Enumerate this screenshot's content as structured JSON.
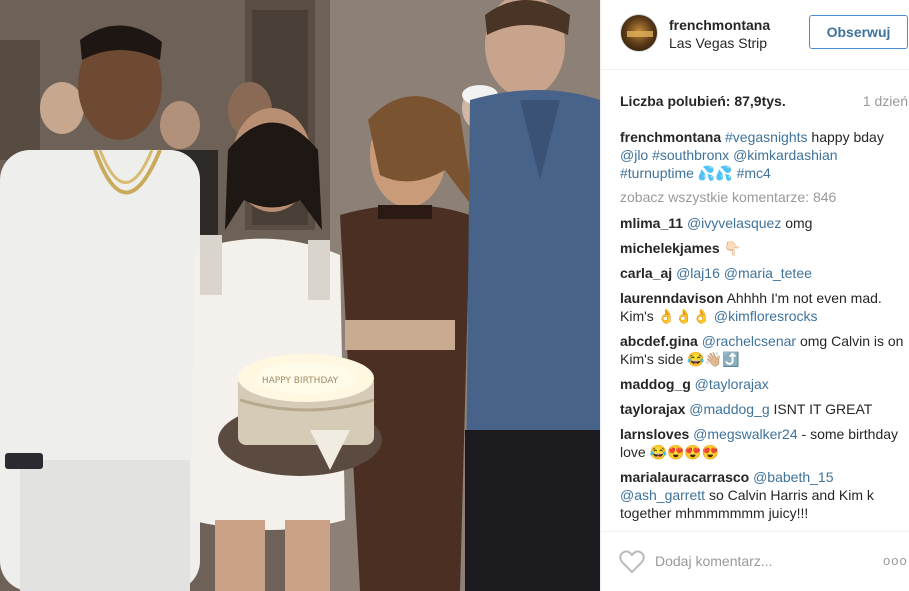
{
  "header": {
    "username": "frenchmontana",
    "location": "Las Vegas Strip",
    "follow_label": "Obserwuj"
  },
  "stats": {
    "likes": "Liczba polubień: 87,9tys.",
    "time": "1 dzień"
  },
  "caption": {
    "user": "frenchmontana",
    "parts": [
      "#vegasnights",
      "happy bday",
      "@jlo",
      "#southbronx",
      "@kimkardashian",
      "#turnuptime",
      "💦💦",
      "#mc4"
    ]
  },
  "view_all": "zobacz wszystkie komentarze: 846",
  "comments": [
    {
      "user": "mlima_11",
      "mention": "@ivyvelasquez",
      "text": "omg"
    },
    {
      "user": "michelekjames",
      "text": "👇🏻"
    },
    {
      "user": "carla_aj",
      "mention": "@laj16 @maria_tetee",
      "text": ""
    },
    {
      "user": "laurenndavison",
      "text": "Ahhhh I'm not even mad. Kim's 👌👌👌",
      "mention2": "@kimfloresrocks"
    },
    {
      "user": "abcdef.gina",
      "mention": "@rachelcsenar",
      "text": "omg Calvin is on Kim's side 😂👋🏼⤴️"
    },
    {
      "user": "maddog_g",
      "mention": "@taylorajax",
      "text": ""
    },
    {
      "user": "taylorajax",
      "mention": "@maddog_g",
      "text": "ISNT IT GREAT"
    },
    {
      "user": "larnsloves",
      "mention": "@megswalker24",
      "text": "- some birthday love 😂😍😍😍"
    },
    {
      "user": "marialauracarrasco",
      "mention": "@babeth_15 @ash_garrett",
      "text": "so Calvin Harris and Kim k together mhmmmmmm juicy!!!"
    }
  ],
  "footer": {
    "add_comment_placeholder": "Dodaj komentarz...",
    "more_label": "ooo"
  },
  "photo": {
    "cake_text": "HAPPY BIRTHDAY"
  }
}
